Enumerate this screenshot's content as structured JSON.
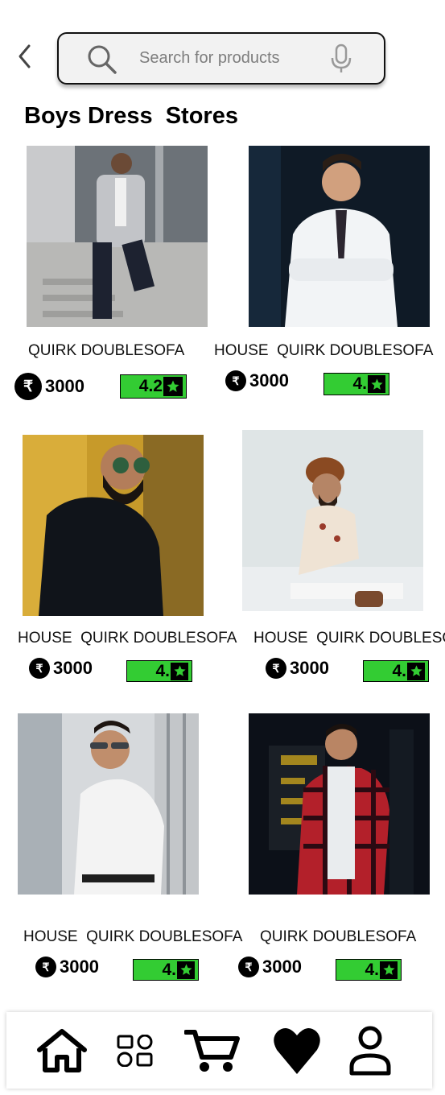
{
  "header": {
    "back_icon": "chevron-left-icon",
    "search_placeholder": "Search for products",
    "search_icon": "search-icon",
    "mic_icon": "microphone-icon"
  },
  "page_title": "Boys Dress  Stores",
  "products": [
    {
      "name": "QUIRK DOUBLESOFA",
      "price": "3000",
      "rating": "4.2",
      "image": "man-in-grey-checked-blazer-photo"
    },
    {
      "name": "HOUSE  QUIRK DOUBLESOFA",
      "price": "3000",
      "rating": "4.",
      "image": "man-in-white-shirt-and-tie-photo"
    },
    {
      "name": "HOUSE  QUIRK DOUBLESOFA",
      "price": "3000",
      "rating": "4.",
      "image": "man-in-black-shirt-with-sunglasses-photo"
    },
    {
      "name": "HOUSE  QUIRK DOUBLESO",
      "price": "3000",
      "rating": "4.",
      "image": "man-with-turban-sitting-photo"
    },
    {
      "name": "HOUSE  QUIRK DOUBLESOFA",
      "price": "3000",
      "rating": "4.",
      "image": "man-in-white-shirt-with-sunglasses-photo"
    },
    {
      "name": "QUIRK DOUBLESOFA",
      "price": "3000",
      "rating": "4.",
      "image": "man-in-red-plaid-jacket-photo"
    }
  ],
  "currency_symbol": "₹",
  "colors": {
    "rating_badge": "#33cc33",
    "accent": "#000000"
  },
  "bottom_nav": [
    {
      "icon": "home-icon"
    },
    {
      "icon": "categories-icon"
    },
    {
      "icon": "cart-icon"
    },
    {
      "icon": "heart-icon"
    },
    {
      "icon": "profile-icon"
    }
  ]
}
